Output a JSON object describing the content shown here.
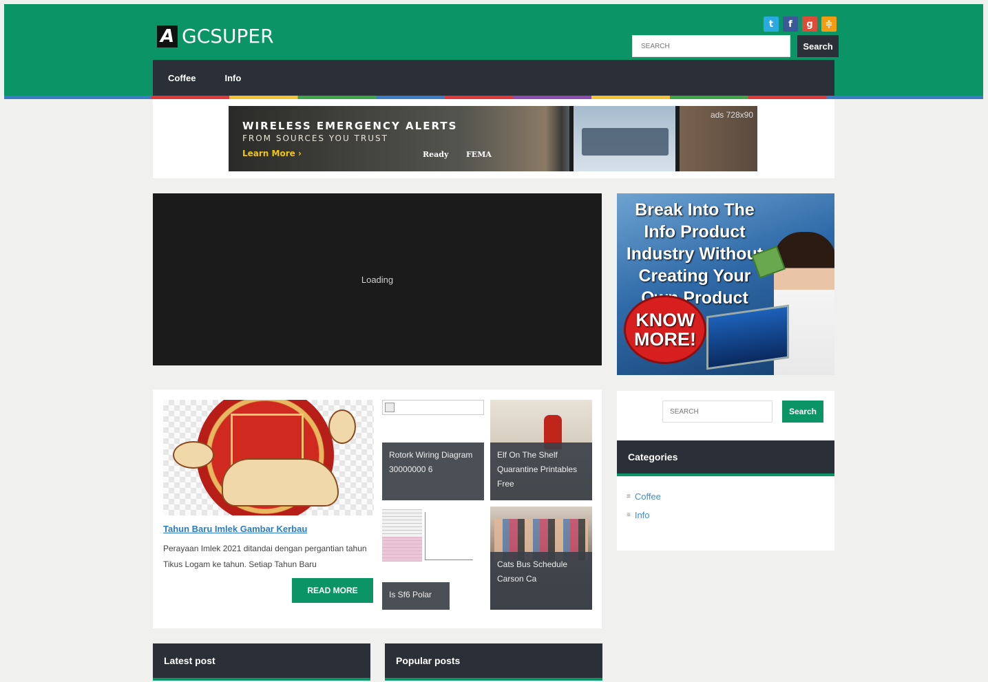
{
  "header": {
    "logo_mark": "A",
    "logo_text": "GCSUPER",
    "search_placeholder": "SEARCH",
    "search_button": "Search",
    "social_icons": [
      "twitter-icon",
      "facebook-icon",
      "google-plus-icon",
      "rss-icon"
    ]
  },
  "nav": {
    "items": [
      "Coffee",
      "Info"
    ]
  },
  "ad_banner": {
    "line1": "WIRELESS EMERGENCY ALERTS",
    "line2": "FROM SOURCES YOU TRUST",
    "cta": "Learn More ›",
    "badge1": "Ready",
    "badge2": "FEMA",
    "label": "ads 728x90"
  },
  "video": {
    "status": "Loading"
  },
  "promo": {
    "headline": "Break Into The Info Product Industry Without Creating Your Own Product",
    "button": "KNOW MORE!"
  },
  "featured": {
    "main": {
      "title": "Tahun Baru Imlek Gambar Kerbau",
      "excerpt": "Perayaan Imlek 2021 ditandai dengan pergantian tahun Tikus Logam ke tahun. Setiap Tahun Baru",
      "read_more": "READ MORE"
    },
    "tiles": [
      {
        "caption": "Rotork Wiring Diagram 30000000 6"
      },
      {
        "caption": "Elf On The Shelf Quarantine Printables Free"
      },
      {
        "caption": "Is Sf6 Polar"
      },
      {
        "caption": "Cats Bus Schedule Carson Ca"
      }
    ]
  },
  "sidebar": {
    "search_placeholder": "SEARCH",
    "search_button": "Search",
    "categories_title": "Categories",
    "categories": [
      "Coffee",
      "Info"
    ]
  },
  "bottom": {
    "latest_title": "Latest post",
    "popular_title": "Popular posts"
  },
  "colors": {
    "brand_green": "#0b9465",
    "dark_bar": "#2b2f38",
    "link_blue": "#2a7cc1",
    "page_bg": "#f0f0ee"
  }
}
